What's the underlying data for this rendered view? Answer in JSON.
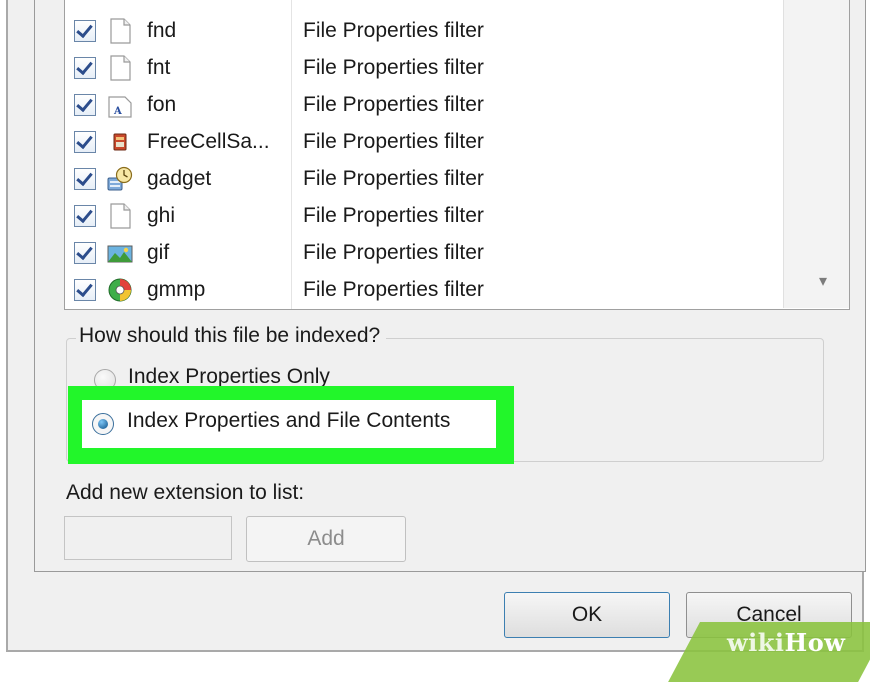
{
  "file_types": [
    {
      "extension": "fnd",
      "filter": "File Properties filter",
      "checked": true,
      "icon": "blank-file-icon"
    },
    {
      "extension": "fnt",
      "filter": "File Properties filter",
      "checked": true,
      "icon": "blank-file-icon"
    },
    {
      "extension": "fon",
      "filter": "File Properties filter",
      "checked": true,
      "icon": "font-file-icon"
    },
    {
      "extension": "FreeCellSa...",
      "filter": "File Properties filter",
      "checked": true,
      "icon": "freecell-save-icon"
    },
    {
      "extension": "gadget",
      "filter": "File Properties filter",
      "checked": true,
      "icon": "gadget-icon"
    },
    {
      "extension": "ghi",
      "filter": "File Properties filter",
      "checked": true,
      "icon": "blank-file-icon"
    },
    {
      "extension": "gif",
      "filter": "File Properties filter",
      "checked": true,
      "icon": "gif-image-icon"
    },
    {
      "extension": "gmmp",
      "filter": "File Properties filter",
      "checked": true,
      "icon": "gmmp-icon"
    }
  ],
  "index_group": {
    "legend": "How should this file be indexed?",
    "option_properties_only": "Index Properties Only",
    "option_properties_and_contents": "Index Properties and File Contents",
    "selected": "Index Properties and File Contents"
  },
  "add_extension": {
    "label": "Add new extension to list:",
    "input_value": "",
    "add_button": "Add"
  },
  "buttons": {
    "ok": "OK",
    "cancel": "Cancel"
  },
  "watermark": {
    "part1": "wiki",
    "part2": "How"
  },
  "colors": {
    "highlight": "#22f62a",
    "ok_border": "#3c7fb1",
    "watermark": "#8ac33d"
  }
}
